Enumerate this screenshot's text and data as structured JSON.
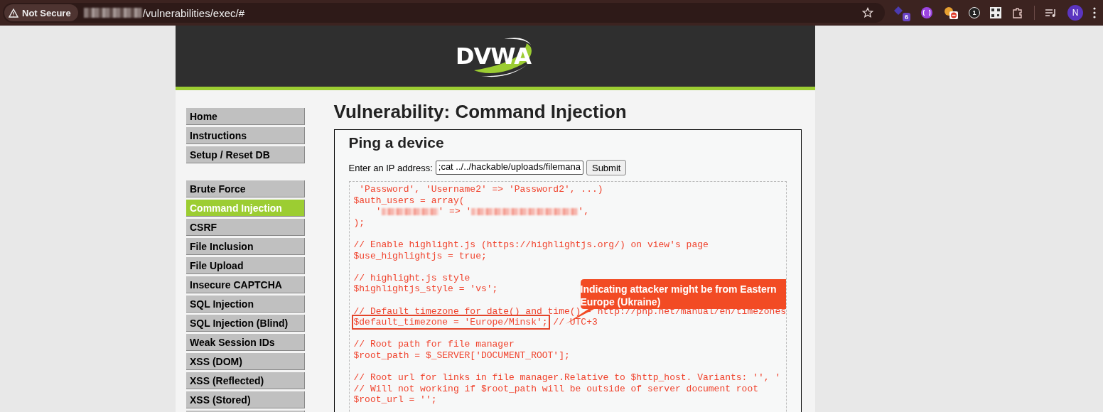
{
  "browser": {
    "security_label": "Not Secure",
    "url_path": "/vulnerabilities/exec/#",
    "extension_badge": "6",
    "extension_count": "1",
    "profile_initial": "N"
  },
  "header": {
    "logo": "DVWA"
  },
  "menu": [
    [
      {
        "label": "Home",
        "selected": false
      },
      {
        "label": "Instructions",
        "selected": false
      },
      {
        "label": "Setup / Reset DB",
        "selected": false
      }
    ],
    [
      {
        "label": "Brute Force",
        "selected": false
      },
      {
        "label": "Command Injection",
        "selected": true
      },
      {
        "label": "CSRF",
        "selected": false
      },
      {
        "label": "File Inclusion",
        "selected": false
      },
      {
        "label": "File Upload",
        "selected": false
      },
      {
        "label": "Insecure CAPTCHA",
        "selected": false
      },
      {
        "label": "SQL Injection",
        "selected": false
      },
      {
        "label": "SQL Injection (Blind)",
        "selected": false
      },
      {
        "label": "Weak Session IDs",
        "selected": false
      },
      {
        "label": "XSS (DOM)",
        "selected": false
      },
      {
        "label": "XSS (Reflected)",
        "selected": false
      },
      {
        "label": "XSS (Stored)",
        "selected": false
      }
    ]
  ],
  "main": {
    "title": "Vulnerability: Command Injection",
    "section_title": "Ping a device",
    "field_label": "Enter an IP address:",
    "field_value": ";cat ../../hackable/uploads/filemana",
    "submit": "Submit",
    "code_lines": [
      {
        "kind": "plain",
        "text": " 'Password', 'Username2' => 'Password2', ...)"
      },
      {
        "kind": "plain",
        "text": "$auth_users = array("
      },
      {
        "kind": "redacted",
        "parts": [
          "    '",
          "' => '",
          "',"
        ]
      },
      {
        "kind": "plain",
        "text": ");"
      },
      {
        "kind": "blank"
      },
      {
        "kind": "plain",
        "text": "// Enable highlight.js (https://highlightjs.org/) on view's page"
      },
      {
        "kind": "plain",
        "text": "$use_highlightjs = true;"
      },
      {
        "kind": "blank"
      },
      {
        "kind": "plain",
        "text": "// highlight.js style"
      },
      {
        "kind": "plain",
        "text": "$highlightjs_style = 'vs';"
      },
      {
        "kind": "blank"
      },
      {
        "kind": "plain",
        "text": "// Default timezone for date() and time() - http://php.net/manual/en/timezones"
      },
      {
        "kind": "boxed",
        "boxed": "$default_timezone = 'Europe/Minsk';",
        "text": " // UTC+3"
      },
      {
        "kind": "blank"
      },
      {
        "kind": "plain",
        "text": "// Root path for file manager"
      },
      {
        "kind": "plain",
        "text": "$root_path = $_SERVER['DOCUMENT_ROOT'];"
      },
      {
        "kind": "blank"
      },
      {
        "kind": "plain",
        "text": "// Root url for links in file manager.Relative to $http_host. Variants: '', '"
      },
      {
        "kind": "plain",
        "text": "// Will not working if $root_path will be outside of server document root"
      },
      {
        "kind": "plain",
        "text": "$root_url = '';"
      }
    ],
    "annotation": "Indicating attacker might be from Eastern Europe (Ukraine)"
  }
}
